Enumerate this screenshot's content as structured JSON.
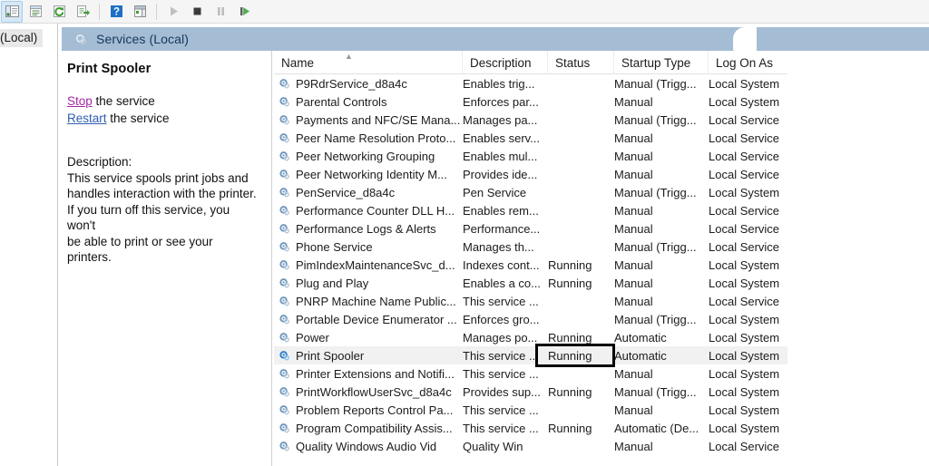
{
  "toolbar": {
    "buttons": [
      {
        "name": "show-hide-console-tree-icon",
        "glyph": "tree",
        "active": true
      },
      {
        "name": "properties-icon",
        "glyph": "properties",
        "active": false
      },
      {
        "name": "refresh-icon",
        "glyph": "refresh",
        "active": false
      },
      {
        "name": "export-list-icon",
        "glyph": "export",
        "active": false
      },
      {
        "name": "help-icon",
        "glyph": "help",
        "active": false
      },
      {
        "name": "show-hide-action-pane-icon",
        "glyph": "actionpane",
        "active": false
      },
      {
        "name": "start-service-icon",
        "glyph": "play",
        "active": false
      },
      {
        "name": "stop-service-icon",
        "glyph": "stop",
        "active": false
      },
      {
        "name": "pause-service-icon",
        "glyph": "pause",
        "active": false
      },
      {
        "name": "restart-service-icon",
        "glyph": "restart",
        "active": false
      }
    ]
  },
  "tree": {
    "node_label": "(Local)"
  },
  "tab": {
    "label": "Services (Local)"
  },
  "detail": {
    "title": "Print Spooler",
    "stop_link": "Stop",
    "stop_suffix": " the service",
    "restart_link": "Restart",
    "restart_suffix": " the service",
    "description_label": "Description:",
    "description_lines": [
      "This service spools print jobs and",
      "handles interaction with the printer.",
      "If you turn off this service, you won't",
      "be able to print or see your printers."
    ]
  },
  "list": {
    "columns": [
      "Name",
      "Description",
      "Status",
      "Startup Type",
      "Log On As"
    ],
    "sort_column": "Name",
    "sort_direction": "ascending",
    "selected_row": "Print Spooler",
    "rows": [
      {
        "name": "P9RdrService_d8a4c",
        "description": "Enables trig...",
        "status": "",
        "startup": "Manual (Trigg...",
        "logon": "Local System"
      },
      {
        "name": "Parental Controls",
        "description": "Enforces par...",
        "status": "",
        "startup": "Manual",
        "logon": "Local System"
      },
      {
        "name": "Payments and NFC/SE Mana...",
        "description": "Manages pa...",
        "status": "",
        "startup": "Manual (Trigg...",
        "logon": "Local Service"
      },
      {
        "name": "Peer Name Resolution Proto...",
        "description": "Enables serv...",
        "status": "",
        "startup": "Manual",
        "logon": "Local Service"
      },
      {
        "name": "Peer Networking Grouping",
        "description": "Enables mul...",
        "status": "",
        "startup": "Manual",
        "logon": "Local Service"
      },
      {
        "name": "Peer Networking Identity M...",
        "description": "Provides ide...",
        "status": "",
        "startup": "Manual",
        "logon": "Local Service"
      },
      {
        "name": "PenService_d8a4c",
        "description": "Pen Service",
        "status": "",
        "startup": "Manual (Trigg...",
        "logon": "Local System"
      },
      {
        "name": "Performance Counter DLL H...",
        "description": "Enables rem...",
        "status": "",
        "startup": "Manual",
        "logon": "Local Service"
      },
      {
        "name": "Performance Logs & Alerts",
        "description": "Performance...",
        "status": "",
        "startup": "Manual",
        "logon": "Local Service"
      },
      {
        "name": "Phone Service",
        "description": "Manages th...",
        "status": "",
        "startup": "Manual (Trigg...",
        "logon": "Local Service"
      },
      {
        "name": "PimIndexMaintenanceSvc_d...",
        "description": "Indexes cont...",
        "status": "Running",
        "startup": "Manual",
        "logon": "Local System"
      },
      {
        "name": "Plug and Play",
        "description": "Enables a co...",
        "status": "Running",
        "startup": "Manual",
        "logon": "Local System"
      },
      {
        "name": "PNRP Machine Name Public...",
        "description": "This service ...",
        "status": "",
        "startup": "Manual",
        "logon": "Local Service"
      },
      {
        "name": "Portable Device Enumerator ...",
        "description": "Enforces gro...",
        "status": "",
        "startup": "Manual (Trigg...",
        "logon": "Local System"
      },
      {
        "name": "Power",
        "description": "Manages po...",
        "status": "Running",
        "startup": "Automatic",
        "logon": "Local System"
      },
      {
        "name": "Print Spooler",
        "description": "This service ...",
        "status": "Running",
        "startup": "Automatic",
        "logon": "Local System"
      },
      {
        "name": "Printer Extensions and Notifi...",
        "description": "This service ...",
        "status": "",
        "startup": "Manual",
        "logon": "Local System"
      },
      {
        "name": "PrintWorkflowUserSvc_d8a4c",
        "description": "Provides sup...",
        "status": "Running",
        "startup": "Manual (Trigg...",
        "logon": "Local System"
      },
      {
        "name": "Problem Reports Control Pa...",
        "description": "This service ...",
        "status": "",
        "startup": "Manual",
        "logon": "Local System"
      },
      {
        "name": "Program Compatibility Assis...",
        "description": "This service ...",
        "status": "Running",
        "startup": "Automatic (De...",
        "logon": "Local System"
      },
      {
        "name": "Quality Windows Audio Vid",
        "description": "Quality Win",
        "status": "",
        "startup": "Manual",
        "logon": "Local Service"
      }
    ]
  },
  "annotation": {
    "name": "running-status-highlight",
    "target_row": "Print Spooler",
    "target_column": "Status",
    "target_value": "Running",
    "color": "#000000"
  }
}
